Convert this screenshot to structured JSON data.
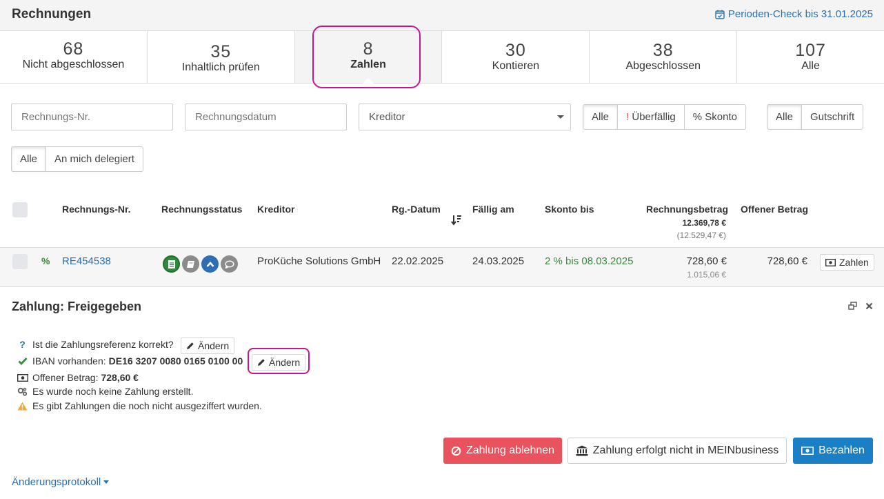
{
  "header": {
    "title": "Rechnungen",
    "period_check": "Perioden-Check bis 31.01.2025"
  },
  "tabs": [
    {
      "count": "68",
      "label": "Nicht abgeschlossen"
    },
    {
      "count": "35",
      "label": "Inhaltlich prüfen"
    },
    {
      "count": "8",
      "label": "Zahlen"
    },
    {
      "count": "30",
      "label": "Kontieren"
    },
    {
      "count": "38",
      "label": "Abgeschlossen"
    },
    {
      "count": "107",
      "label": "Alle"
    }
  ],
  "active_tab": "Zahlen",
  "filters": {
    "invoice_no_placeholder": "Rechnungs-Nr.",
    "invoice_date_placeholder": "Rechnungsdatum",
    "creditor_select": "Kreditor",
    "due_group": [
      "Alle",
      "Überfällig",
      "Skonto"
    ],
    "due_prefix_overdue": "!",
    "due_prefix_skonto": "%",
    "type_group": [
      "Alle",
      "Gutschrift"
    ],
    "delegation_group": [
      "Alle",
      "An mich delegiert"
    ]
  },
  "table": {
    "columns": {
      "invoice_no": "Rechnungs-Nr.",
      "status": "Rechnungsstatus",
      "creditor": "Kreditor",
      "invoice_date": "Rg.-Datum",
      "due_date": "Fällig am",
      "skonto": "Skonto bis",
      "amount": "Rechnungsbetrag",
      "amount_total": "12.369,78 €",
      "amount_total_gross": "(12.529,47 €)",
      "open_amount": "Offener Betrag"
    },
    "rows": [
      {
        "flag": "%",
        "invoice_no": "RE454538",
        "creditor": "ProKüche Solutions GmbH",
        "invoice_date": "22.02.2025",
        "due_date": "24.03.2025",
        "skonto": "2 % bis 08.03.2025",
        "amount": "728,60 €",
        "amount_gross": "1.015,06 €",
        "open_amount": "728,60 €",
        "pay_button": "Zahlen"
      }
    ]
  },
  "payment_panel": {
    "title": "Zahlung: Freigegeben",
    "checks": {
      "reference_question": "Ist die Zahlungsreferenz korrekt?",
      "change_label": "Ändern",
      "iban_label": "IBAN vorhanden:",
      "iban_value": "DE16 3207 0080 0165 0100 00",
      "open_amount_label": "Offener Betrag:",
      "open_amount_value": "728,60 €",
      "no_payment": "Es wurde noch keine Zahlung erstellt.",
      "warning": "Es gibt Zahlungen die noch nicht ausgeziffert wurden."
    },
    "actions": {
      "reject": "Zahlung ablehnen",
      "external": "Zahlung erfolgt nicht in MEINbusiness",
      "pay": "Bezahlen"
    },
    "changelog": "Änderungsprotokoll"
  },
  "colors": {
    "accent": "#2a6fb0",
    "danger": "#e8535e",
    "primary": "#1a7fc4",
    "success": "#3b8a3e",
    "highlight": "#c2188f"
  }
}
